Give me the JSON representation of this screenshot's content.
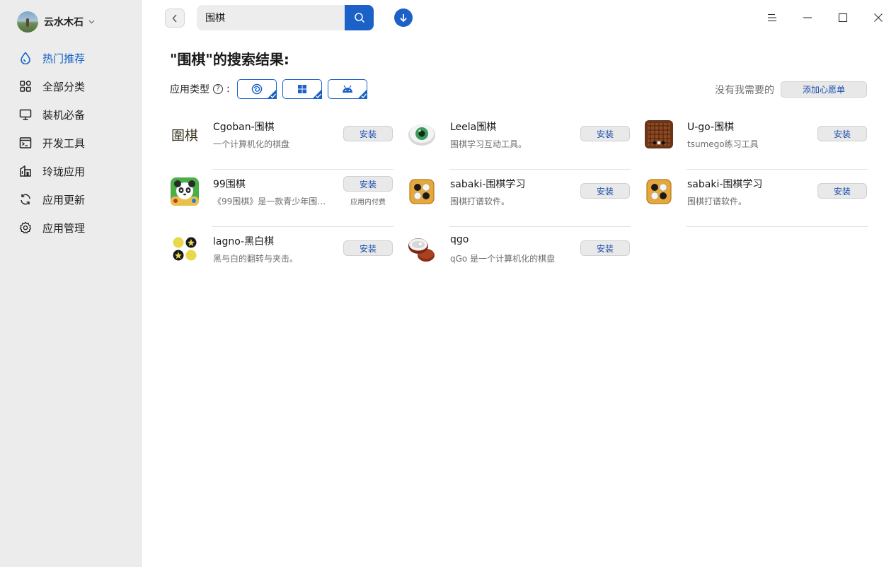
{
  "user": {
    "name": "云水木石"
  },
  "sidebar": {
    "items": [
      {
        "label": "热门推荐",
        "icon": "drop-icon",
        "active": true
      },
      {
        "label": "全部分类",
        "icon": "grid-icon"
      },
      {
        "label": "装机必备",
        "icon": "monitor-icon"
      },
      {
        "label": "开发工具",
        "icon": "terminal-icon"
      },
      {
        "label": "玲珑应用",
        "icon": "building-icon"
      },
      {
        "label": "应用更新",
        "icon": "refresh-icon"
      },
      {
        "label": "应用管理",
        "icon": "settings-icon"
      }
    ]
  },
  "search": {
    "value": "围棋"
  },
  "results": {
    "title": "\"围棋\"的搜索结果:"
  },
  "filter": {
    "label": "应用类型",
    "colon": ":",
    "wish_text": "没有我需要的",
    "wish_button": "添加心愿单"
  },
  "apps": [
    {
      "name": "Cgoban-围棋",
      "desc": "一个计算机化的棋盘",
      "button": "安装"
    },
    {
      "name": "Leela围棋",
      "desc": "围棋学习互动工具。",
      "button": "安装"
    },
    {
      "name": "U-go-围棋",
      "desc": "tsumego练习工具",
      "button": "安装"
    },
    {
      "name": "99围棋",
      "desc": "《99围棋》是一款青少年围…",
      "button": "安装",
      "note": "应用内付费"
    },
    {
      "name": "sabaki-围棋学习",
      "desc": "围棋打谱软件。",
      "button": "安装"
    },
    {
      "name": "sabaki-围棋学习",
      "desc": "围棋打谱软件。",
      "button": "安装"
    },
    {
      "name": "lagno-黑白棋",
      "desc": "黑与白的翻转与夹击。",
      "button": "安装"
    },
    {
      "name": "qgo",
      "desc": "qGo 是一个计算机化的棋盘",
      "button": "安装"
    }
  ],
  "cgoban_logo_text": "圍棋",
  "colors": {
    "accent": "#1b61c7",
    "sidebar_bg": "#ececec"
  }
}
